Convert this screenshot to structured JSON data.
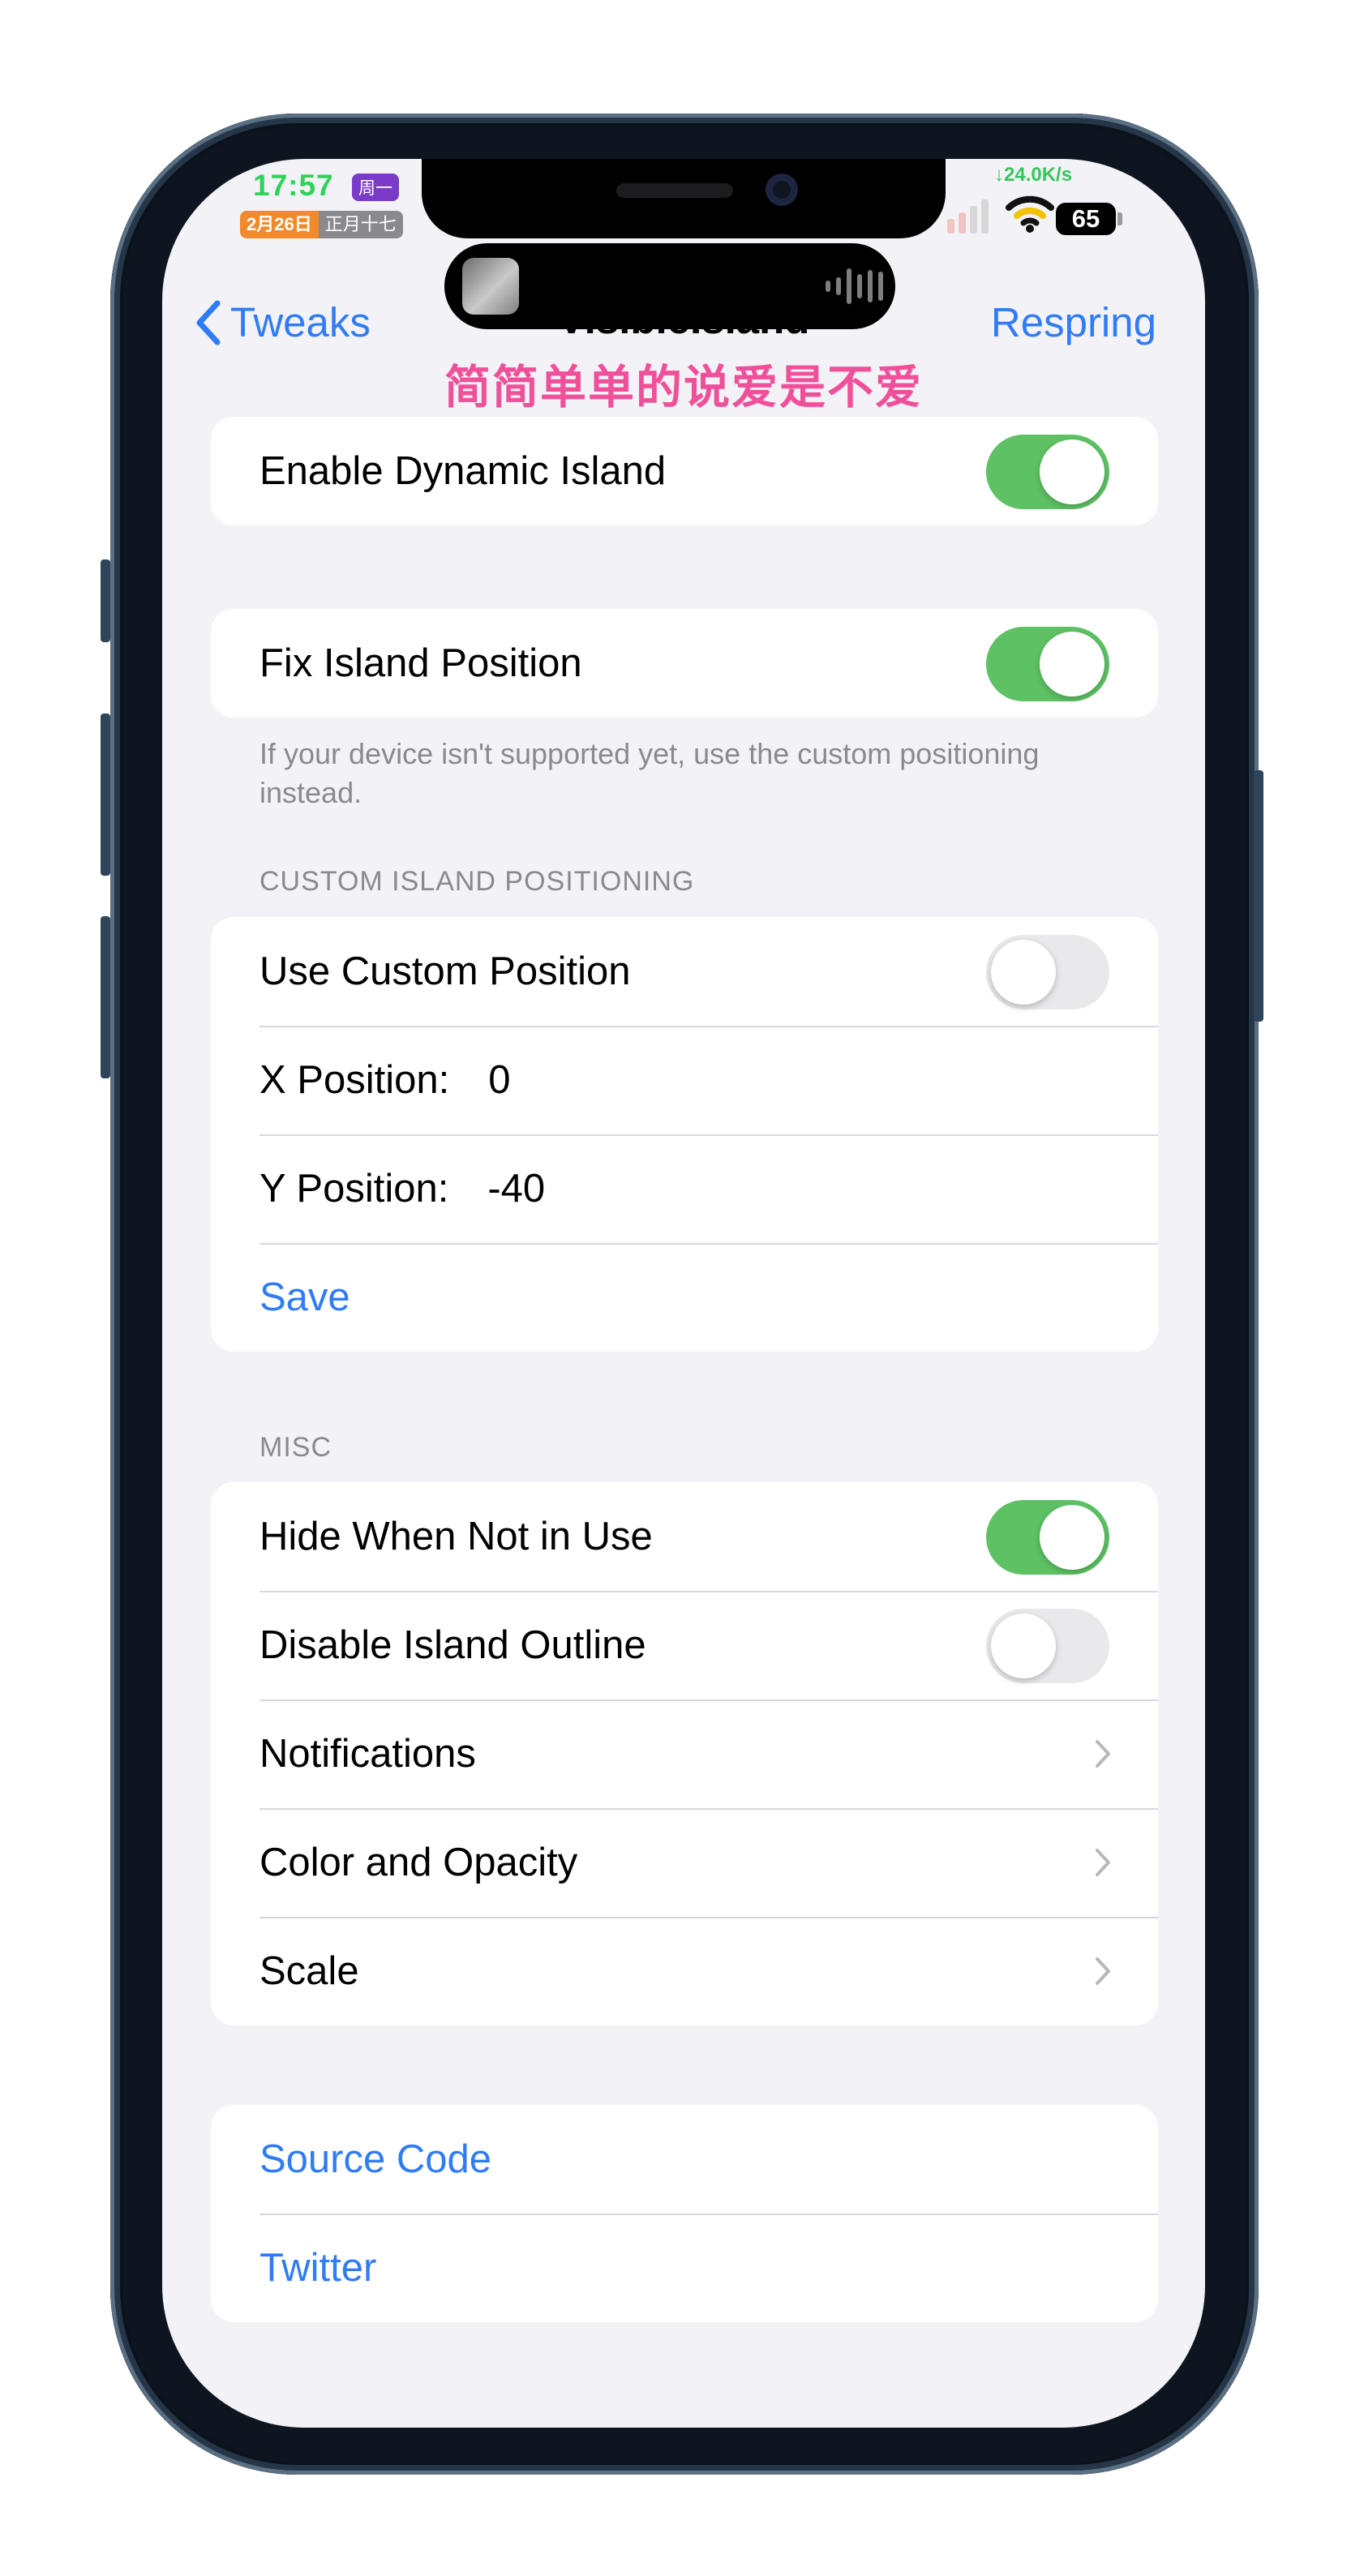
{
  "status_bar": {
    "time": "17:57",
    "weekday": "周一",
    "date": "2月26日",
    "lunar": "正月十七",
    "net_speed": "↓24.0K/s",
    "battery": "65"
  },
  "nav": {
    "back_label": "Tweaks",
    "title": "VisibleIsland",
    "action_label": "Respring"
  },
  "overlay_text": "简简单单的说爱是不爱",
  "groups": {
    "enable": {
      "label": "Enable Dynamic Island",
      "on": true
    },
    "fix": {
      "label": "Fix Island Position",
      "on": true,
      "footer": "If your device isn't supported yet, use the custom positioning instead."
    },
    "custom": {
      "header": "CUSTOM ISLAND POSITIONING",
      "use_custom_label": "Use Custom Position",
      "use_custom_on": false,
      "x_label": "X Position:",
      "x_value": "0",
      "y_label": "Y Position:",
      "y_value": "-40",
      "save_label": "Save"
    },
    "misc": {
      "header": "MISC",
      "hide_label": "Hide When Not in Use",
      "hide_on": true,
      "outline_label": "Disable Island Outline",
      "outline_on": false,
      "notifications_label": "Notifications",
      "color_label": "Color and Opacity",
      "scale_label": "Scale"
    },
    "links": {
      "source_label": "Source Code",
      "twitter_label": "Twitter"
    }
  },
  "colors": {
    "accent": "#2f7cf6",
    "toggle_on": "#5ec264",
    "overlay_text": "#f0509a",
    "status_time": "#2fd457"
  }
}
